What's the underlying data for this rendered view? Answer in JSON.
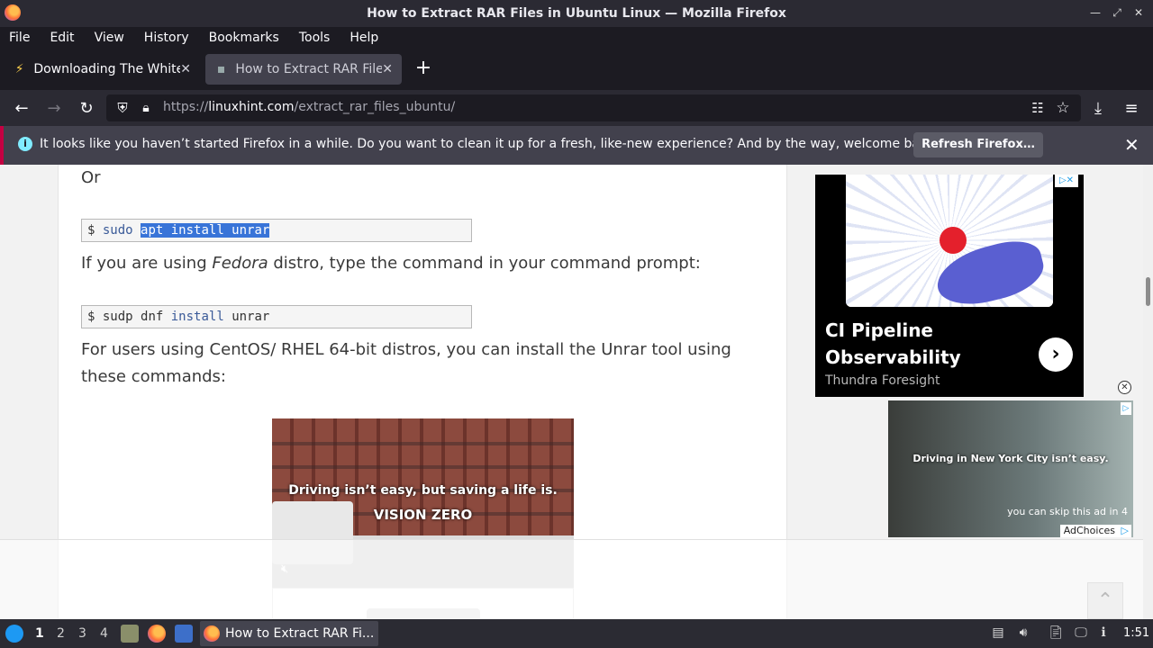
{
  "window": {
    "title": "How to Extract RAR Files in Ubuntu Linux — Mozilla Firefox",
    "controls": [
      "minimize-icon",
      "restore-icon",
      "close-icon"
    ]
  },
  "menubar": {
    "items": [
      "File",
      "Edit",
      "View",
      "History",
      "Bookmarks",
      "Tools",
      "Help"
    ]
  },
  "tabs": [
    {
      "label": "Downloading The White H",
      "active": false,
      "icon": "bolt-icon"
    },
    {
      "label": "How to Extract RAR Files",
      "active": true,
      "icon": "site-icon"
    }
  ],
  "newtab": {
    "label": "+"
  },
  "navbar": {
    "url_scheme": "https://",
    "url_host": "linuxhint.com",
    "url_path": "/extract_rar_files_ubuntu/"
  },
  "notification": {
    "text": "It looks like you haven’t started Firefox in a while. Do you want to clean it up for a fresh, like-new experience? And by the way, welcome back!",
    "button": "Refresh Firefox…",
    "accent": "#c50042"
  },
  "article": {
    "or_text": "Or",
    "code1": {
      "prompt": "$",
      "cmd": "sudo",
      "selected": "apt install unrar"
    },
    "fedora_pre": "If you are using ",
    "fedora_em": "Fedora",
    "fedora_post": " distro, type the command in your command prompt:",
    "code2": {
      "prompt": "$",
      "cmd": "sudp dnf",
      "kw": "install",
      "arg": "unrar"
    },
    "centos_text": "For users using CentOS/ RHEL 64-bit distros, you can install the Unrar tool using these commands:"
  },
  "video_ad": {
    "line1": "Driving isn’t easy, but saving a life is.",
    "line2": "VISION ZERO"
  },
  "side_ad": {
    "title": "CI Pipeline Observability",
    "brand": "Thundra Foresight",
    "arrow": "›"
  },
  "side_video": {
    "caption": "Driving in New York City isn’t easy.",
    "skip": "you can skip this ad in 4",
    "adchoices": "AdChoices"
  },
  "taskbar": {
    "workspaces": [
      "1",
      "2",
      "3",
      "4"
    ],
    "active_workspace": "1",
    "task_label": "How to Extract RAR Fi...",
    "clock": "1:51"
  }
}
